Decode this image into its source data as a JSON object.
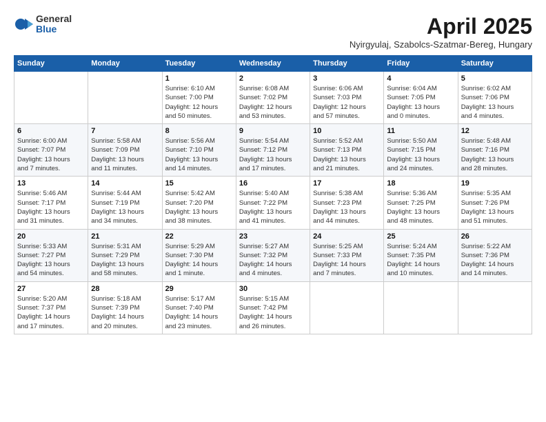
{
  "logo": {
    "general": "General",
    "blue": "Blue"
  },
  "title": "April 2025",
  "location": "Nyirgyulaj, Szabolcs-Szatmar-Bereg, Hungary",
  "days_of_week": [
    "Sunday",
    "Monday",
    "Tuesday",
    "Wednesday",
    "Thursday",
    "Friday",
    "Saturday"
  ],
  "weeks": [
    [
      {
        "day": "",
        "info": ""
      },
      {
        "day": "",
        "info": ""
      },
      {
        "day": "1",
        "info": "Sunrise: 6:10 AM\nSunset: 7:00 PM\nDaylight: 12 hours\nand 50 minutes."
      },
      {
        "day": "2",
        "info": "Sunrise: 6:08 AM\nSunset: 7:02 PM\nDaylight: 12 hours\nand 53 minutes."
      },
      {
        "day": "3",
        "info": "Sunrise: 6:06 AM\nSunset: 7:03 PM\nDaylight: 12 hours\nand 57 minutes."
      },
      {
        "day": "4",
        "info": "Sunrise: 6:04 AM\nSunset: 7:05 PM\nDaylight: 13 hours\nand 0 minutes."
      },
      {
        "day": "5",
        "info": "Sunrise: 6:02 AM\nSunset: 7:06 PM\nDaylight: 13 hours\nand 4 minutes."
      }
    ],
    [
      {
        "day": "6",
        "info": "Sunrise: 6:00 AM\nSunset: 7:07 PM\nDaylight: 13 hours\nand 7 minutes."
      },
      {
        "day": "7",
        "info": "Sunrise: 5:58 AM\nSunset: 7:09 PM\nDaylight: 13 hours\nand 11 minutes."
      },
      {
        "day": "8",
        "info": "Sunrise: 5:56 AM\nSunset: 7:10 PM\nDaylight: 13 hours\nand 14 minutes."
      },
      {
        "day": "9",
        "info": "Sunrise: 5:54 AM\nSunset: 7:12 PM\nDaylight: 13 hours\nand 17 minutes."
      },
      {
        "day": "10",
        "info": "Sunrise: 5:52 AM\nSunset: 7:13 PM\nDaylight: 13 hours\nand 21 minutes."
      },
      {
        "day": "11",
        "info": "Sunrise: 5:50 AM\nSunset: 7:15 PM\nDaylight: 13 hours\nand 24 minutes."
      },
      {
        "day": "12",
        "info": "Sunrise: 5:48 AM\nSunset: 7:16 PM\nDaylight: 13 hours\nand 28 minutes."
      }
    ],
    [
      {
        "day": "13",
        "info": "Sunrise: 5:46 AM\nSunset: 7:17 PM\nDaylight: 13 hours\nand 31 minutes."
      },
      {
        "day": "14",
        "info": "Sunrise: 5:44 AM\nSunset: 7:19 PM\nDaylight: 13 hours\nand 34 minutes."
      },
      {
        "day": "15",
        "info": "Sunrise: 5:42 AM\nSunset: 7:20 PM\nDaylight: 13 hours\nand 38 minutes."
      },
      {
        "day": "16",
        "info": "Sunrise: 5:40 AM\nSunset: 7:22 PM\nDaylight: 13 hours\nand 41 minutes."
      },
      {
        "day": "17",
        "info": "Sunrise: 5:38 AM\nSunset: 7:23 PM\nDaylight: 13 hours\nand 44 minutes."
      },
      {
        "day": "18",
        "info": "Sunrise: 5:36 AM\nSunset: 7:25 PM\nDaylight: 13 hours\nand 48 minutes."
      },
      {
        "day": "19",
        "info": "Sunrise: 5:35 AM\nSunset: 7:26 PM\nDaylight: 13 hours\nand 51 minutes."
      }
    ],
    [
      {
        "day": "20",
        "info": "Sunrise: 5:33 AM\nSunset: 7:27 PM\nDaylight: 13 hours\nand 54 minutes."
      },
      {
        "day": "21",
        "info": "Sunrise: 5:31 AM\nSunset: 7:29 PM\nDaylight: 13 hours\nand 58 minutes."
      },
      {
        "day": "22",
        "info": "Sunrise: 5:29 AM\nSunset: 7:30 PM\nDaylight: 14 hours\nand 1 minute."
      },
      {
        "day": "23",
        "info": "Sunrise: 5:27 AM\nSunset: 7:32 PM\nDaylight: 14 hours\nand 4 minutes."
      },
      {
        "day": "24",
        "info": "Sunrise: 5:25 AM\nSunset: 7:33 PM\nDaylight: 14 hours\nand 7 minutes."
      },
      {
        "day": "25",
        "info": "Sunrise: 5:24 AM\nSunset: 7:35 PM\nDaylight: 14 hours\nand 10 minutes."
      },
      {
        "day": "26",
        "info": "Sunrise: 5:22 AM\nSunset: 7:36 PM\nDaylight: 14 hours\nand 14 minutes."
      }
    ],
    [
      {
        "day": "27",
        "info": "Sunrise: 5:20 AM\nSunset: 7:37 PM\nDaylight: 14 hours\nand 17 minutes."
      },
      {
        "day": "28",
        "info": "Sunrise: 5:18 AM\nSunset: 7:39 PM\nDaylight: 14 hours\nand 20 minutes."
      },
      {
        "day": "29",
        "info": "Sunrise: 5:17 AM\nSunset: 7:40 PM\nDaylight: 14 hours\nand 23 minutes."
      },
      {
        "day": "30",
        "info": "Sunrise: 5:15 AM\nSunset: 7:42 PM\nDaylight: 14 hours\nand 26 minutes."
      },
      {
        "day": "",
        "info": ""
      },
      {
        "day": "",
        "info": ""
      },
      {
        "day": "",
        "info": ""
      }
    ]
  ]
}
